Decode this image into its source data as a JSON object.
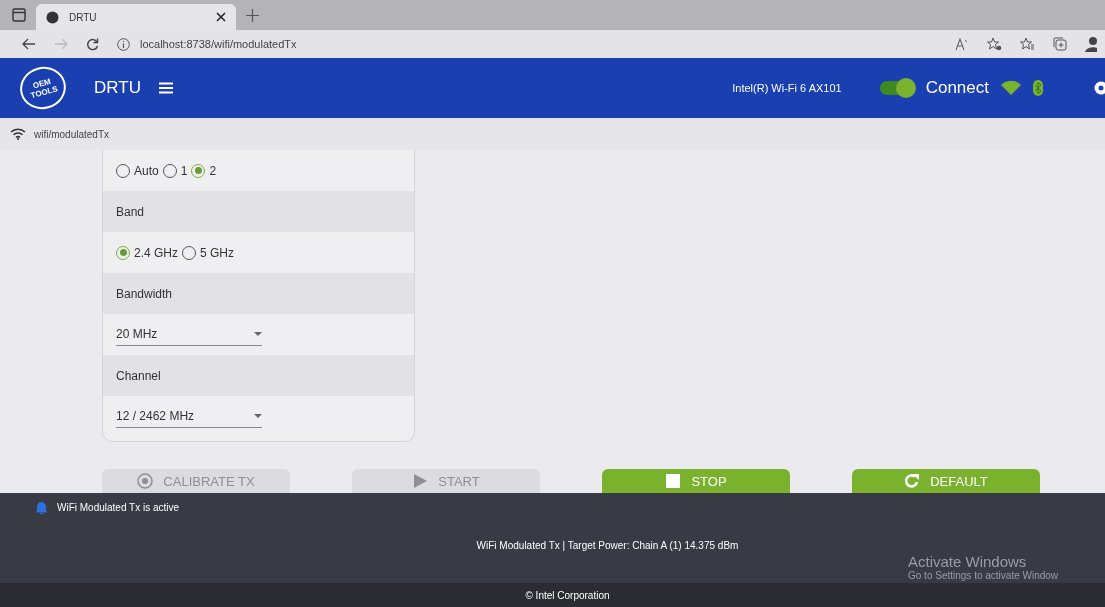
{
  "browser": {
    "tab_title": "DRTU",
    "url": "localhost:8738/wifi/modulatedTx"
  },
  "header": {
    "logo_lines": [
      "OEM",
      "TOOLS"
    ],
    "app_name": "DRTU",
    "adapter": "Intel(R) Wi-Fi 6 AX101",
    "connect": {
      "label": "Connect",
      "on": true
    }
  },
  "breadcrumb": "wifi/modulatedTx",
  "form": [
    {
      "kind": "radio",
      "options": [
        {
          "label": "Auto",
          "selected": false
        },
        {
          "label": "1",
          "selected": false
        },
        {
          "label": "2",
          "selected": true
        }
      ]
    },
    {
      "kind": "heading",
      "label": "Band"
    },
    {
      "kind": "radio",
      "options": [
        {
          "label": "2.4 GHz",
          "selected": true
        },
        {
          "label": "5 GHz",
          "selected": false
        }
      ]
    },
    {
      "kind": "heading",
      "label": "Bandwidth"
    },
    {
      "kind": "select",
      "value": "20 MHz"
    },
    {
      "kind": "heading",
      "label": "Channel"
    },
    {
      "kind": "select",
      "value": "12 / 2462 MHz"
    }
  ],
  "buttons": [
    {
      "label": "CALIBRATE TX",
      "kind": "calibrate",
      "disabled": true
    },
    {
      "label": "START",
      "kind": "start",
      "disabled": true
    },
    {
      "label": "STOP",
      "kind": "stop",
      "disabled": false
    },
    {
      "label": "DEFAULT",
      "kind": "reset",
      "disabled": false
    }
  ],
  "notification": "WiFi Modulated Tx is active",
  "status": "WiFi Modulated Tx | Target Power: Chain A (1) 14.375 dBm",
  "os_notice": {
    "title": "Activate Windows",
    "text": "Go to Settings to activate Window"
  },
  "footer": "© Intel Corporation"
}
